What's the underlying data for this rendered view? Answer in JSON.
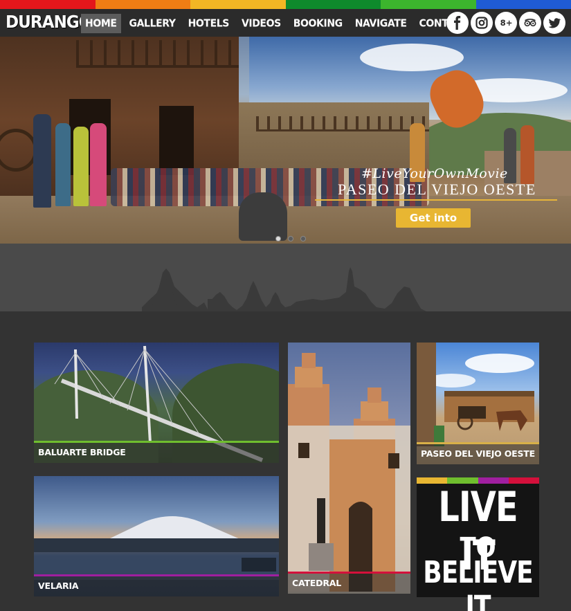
{
  "colors": {
    "stripe": [
      "#e4161b",
      "#f07d14",
      "#f2b624",
      "#0e8a2c",
      "#3cb52d",
      "#1f5bd4"
    ],
    "cta": "#e8b632",
    "caption_bars": {
      "bridge": "#6fbe2e",
      "velaria": "#a01fa0",
      "catedral": "#d4103b",
      "oeste": "#d8b048"
    },
    "live_stripes": [
      "#e8b632",
      "#6fbe2e",
      "#a01fa0",
      "#d4103b"
    ]
  },
  "header": {
    "logo": "DURANGO",
    "nav": [
      {
        "label": "HOME",
        "active": true
      },
      {
        "label": "GALLERY",
        "active": false
      },
      {
        "label": "HOTELS",
        "active": false
      },
      {
        "label": "VIDEOS",
        "active": false
      },
      {
        "label": "BOOKING",
        "active": false
      },
      {
        "label": "NAVIGATE",
        "active": false
      },
      {
        "label": "CONTACT",
        "active": false
      }
    ],
    "social": [
      {
        "icon": "facebook-icon",
        "glyph": "f"
      },
      {
        "icon": "instagram-icon",
        "glyph": ""
      },
      {
        "icon": "google-plus-icon",
        "glyph": "g+"
      },
      {
        "icon": "tripadvisor-icon",
        "glyph": ""
      },
      {
        "icon": "twitter-icon",
        "glyph": ""
      }
    ]
  },
  "hero": {
    "tagline": "#LiveYourOwnMovie",
    "title": "PASEO DEL VIEJO OESTE",
    "cta": "Get into",
    "slides": 3,
    "active_slide": 1
  },
  "tiles": {
    "bridge": "BALUARTE BRIDGE",
    "velaria": "VELARIA",
    "catedral": "CATEDRAL",
    "oeste": "PASEO DEL VIEJO OESTE"
  },
  "live": {
    "line1": "LIVE IT",
    "line2": "TO",
    "line3": "BELIEVE IT"
  }
}
